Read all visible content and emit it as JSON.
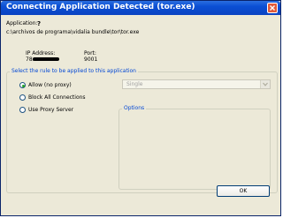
{
  "window": {
    "title": "Connecting Application Detected (tor.exe)"
  },
  "application": {
    "label": "Application:",
    "name_icon": "?",
    "path": "c:\\archivos de programa\\vidalia bundle\\tor\\tor.exe"
  },
  "connection": {
    "ip_label": "IP Address:",
    "ip_value_visible": "78.",
    "port_label": "Port:",
    "port_value": "9001"
  },
  "rule_group": {
    "legend": "Select the rule to be applied to this application",
    "options": [
      {
        "label": "Allow (no proxy)",
        "selected": true
      },
      {
        "label": "Block All Connections",
        "selected": false
      },
      {
        "label": "Use Proxy Server",
        "selected": false
      }
    ],
    "dropdown_value": "Single",
    "options_legend": "Options"
  },
  "buttons": {
    "ok_label": "OK"
  },
  "colors": {
    "titlebar": "#0b4fd3",
    "group_legend": "#0046d5",
    "radio_selected": "#21a121",
    "close_button": "#e05a3a"
  }
}
